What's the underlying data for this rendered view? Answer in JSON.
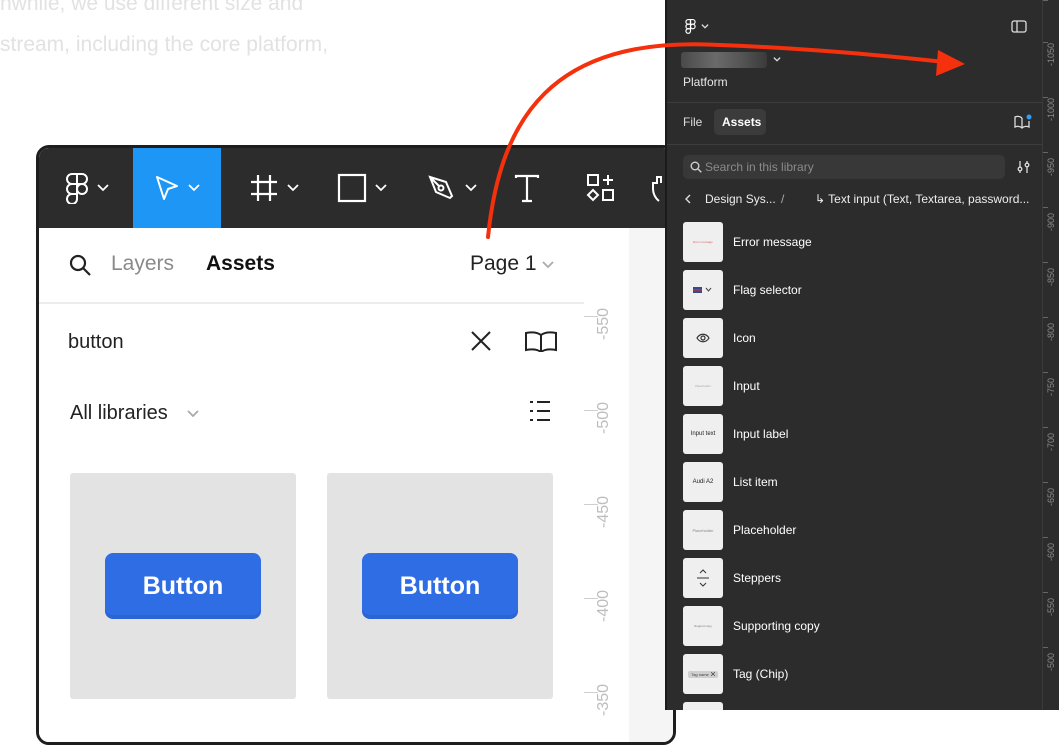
{
  "background_text": {
    "line1": "nwhile, we use different size and",
    "line2": "stream, including the core platform,"
  },
  "old_ui": {
    "tabs": {
      "layers": "Layers",
      "assets": "Assets"
    },
    "page_label": "Page 1",
    "search_value": "button",
    "libraries_label": "All libraries",
    "cards": [
      {
        "label": "Button"
      },
      {
        "label": "Button"
      }
    ],
    "ruler_labels": [
      "-550",
      "-500",
      "-450",
      "-400",
      "-350"
    ]
  },
  "new_ui": {
    "project_name": "Platform",
    "tabs": {
      "file": "File",
      "assets": "Assets"
    },
    "search_placeholder": "Search in this library",
    "breadcrumb": {
      "parent": "Design Sys...",
      "separator": "/",
      "current": "↳ Text input (Text, Textarea, password..."
    },
    "thumb_texts": {
      "error": "Error message",
      "input": "Placeholder",
      "input_label": "Input text",
      "list_item": "Audi A2",
      "placeholder": "Placeholder",
      "supporting": "Support copy",
      "tag": "Tag name"
    },
    "items": [
      {
        "label": "Error message"
      },
      {
        "label": "Flag selector"
      },
      {
        "label": "Icon"
      },
      {
        "label": "Input"
      },
      {
        "label": "Input label"
      },
      {
        "label": "List item"
      },
      {
        "label": "Placeholder"
      },
      {
        "label": "Steppers"
      },
      {
        "label": "Supporting copy"
      },
      {
        "label": "Tag (Chip)"
      }
    ],
    "ruler_labels": [
      "-1050",
      "-1000",
      "-950",
      "-900",
      "-850",
      "-800",
      "-750",
      "-700",
      "-650",
      "-600",
      "-550",
      "-500"
    ]
  },
  "colors": {
    "accent_blue": "#1e96f6",
    "button_blue": "#2f6de5",
    "arrow_red": "#f5300d",
    "dark_panel": "#2c2c2c"
  }
}
